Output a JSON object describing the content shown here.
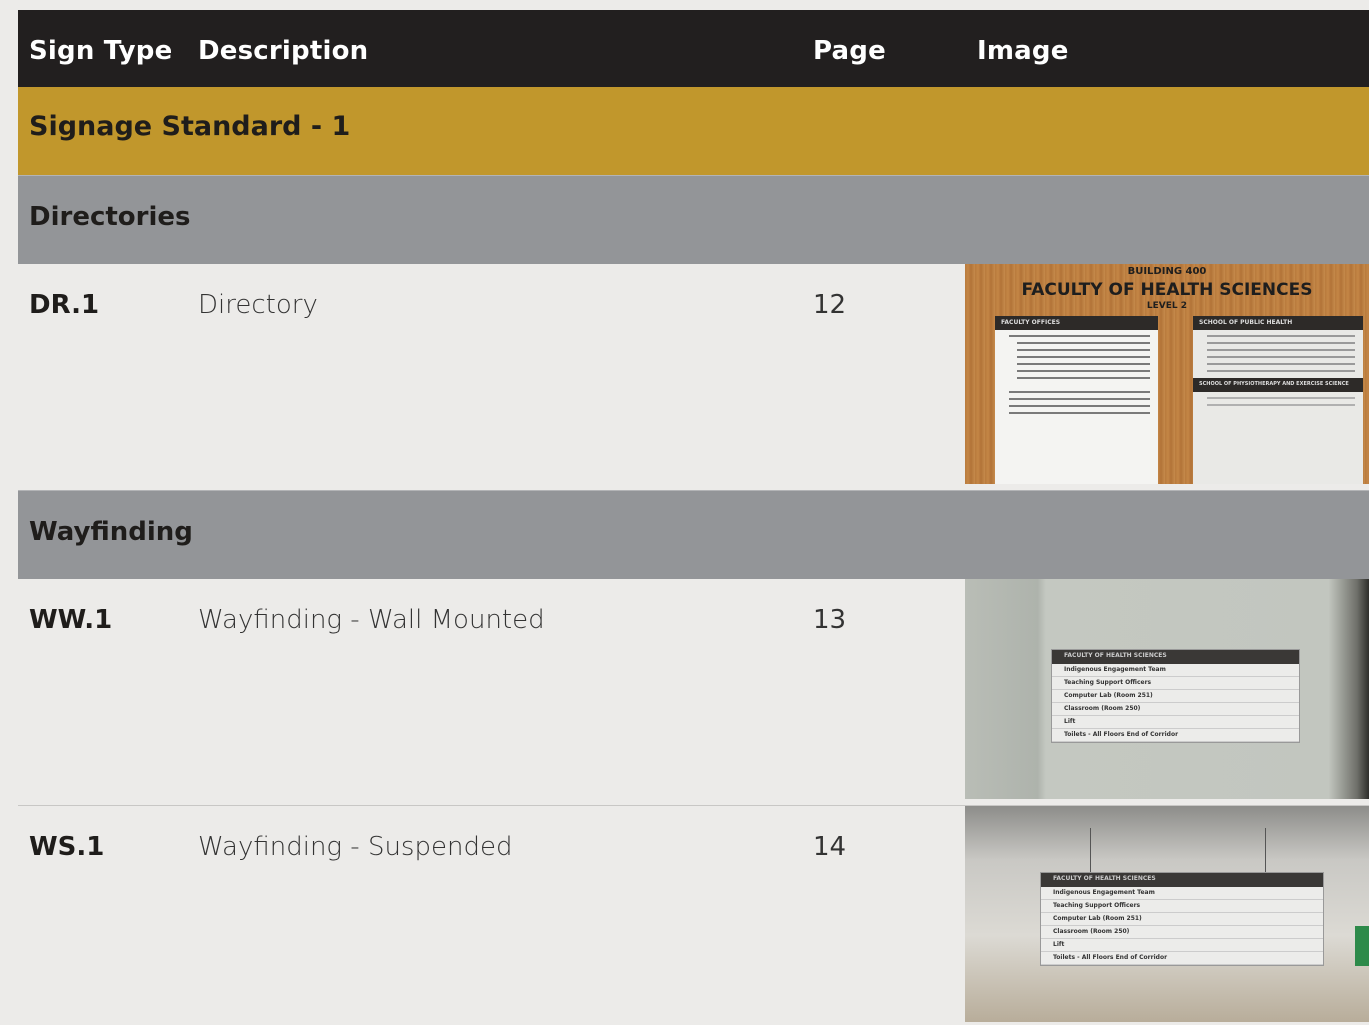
{
  "columns": {
    "sign_type": "Sign Type",
    "description": "Description",
    "page": "Page",
    "image": "Image"
  },
  "section": "Signage Standard - 1",
  "groups": {
    "directories": "Directories",
    "wayfinding": "Wayfinding"
  },
  "rows": [
    {
      "code": "DR.1",
      "description": "Directory",
      "page": "12"
    },
    {
      "code": "WW.1",
      "description": "Wayfinding - Wall Mounted",
      "page": "13"
    },
    {
      "code": "WS.1",
      "description": "Wayfinding - Suspended",
      "page": "14"
    }
  ],
  "images": {
    "directory": {
      "building": "BUILDING 400",
      "title": "FACULTY OF HEALTH SCIENCES",
      "level": "LEVEL 2",
      "left_header": "FACULTY OFFICES",
      "right_header": "SCHOOL OF PUBLIC HEALTH",
      "right_header_2": "SCHOOL OF PHYSIOTHERAPY AND EXERCISE SCIENCE"
    },
    "wayfinding": {
      "header": "FACULTY OF HEALTH SCIENCES",
      "lines": [
        "Indigenous Engagement Team",
        "Teaching Support Officers",
        "Computer Lab (Room 251)",
        "Classroom (Room 250)",
        "Lift",
        "Toilets - All Floors End of Corridor"
      ]
    }
  },
  "colors": {
    "header_bg": "#221f1f",
    "section_bg": "#c1972c",
    "group_bg": "#939598",
    "row_bg": "#ecebe9"
  }
}
